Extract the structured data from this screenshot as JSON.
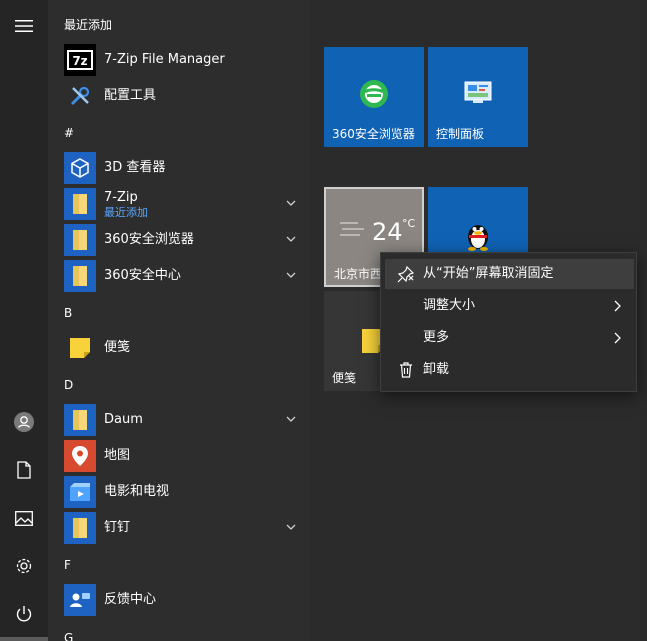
{
  "rail": {
    "icons": [
      "hamburger-menu-icon",
      "user-avatar-icon",
      "documents-icon",
      "pictures-icon",
      "settings-gear-icon",
      "power-icon"
    ]
  },
  "applist": {
    "sections": [
      {
        "letter": "最近添加"
      },
      {
        "letter": "#"
      },
      {
        "letter": "B"
      },
      {
        "letter": "D"
      },
      {
        "letter": "F"
      },
      {
        "letter": "G"
      }
    ],
    "apps": [
      {
        "label": "7-Zip File Manager",
        "icon": "7zip-icon"
      },
      {
        "label": "配置工具",
        "icon": "tools-icon"
      },
      {
        "label": "3D 查看器",
        "icon": "3d-viewer-icon"
      },
      {
        "label": "7-Zip",
        "sublabel": "最近添加",
        "icon": "folder-icon",
        "expandable": true
      },
      {
        "label": "360安全浏览器",
        "icon": "folder-icon",
        "expandable": true
      },
      {
        "label": "360安全中心",
        "icon": "folder-icon",
        "expandable": true
      },
      {
        "label": "便笺",
        "icon": "sticky-notes-icon"
      },
      {
        "label": "Daum",
        "icon": "folder-icon",
        "expandable": true
      },
      {
        "label": "地图",
        "icon": "maps-icon"
      },
      {
        "label": "电影和电视",
        "icon": "movies-tv-icon"
      },
      {
        "label": "钉钉",
        "icon": "folder-icon",
        "expandable": true
      },
      {
        "label": "反馈中心",
        "icon": "feedback-hub-icon"
      }
    ]
  },
  "tiles": {
    "browser": {
      "label": "360安全浏览器",
      "icon": "360-browser-icon"
    },
    "control_panel": {
      "label": "控制面板",
      "icon": "control-panel-icon"
    },
    "weather": {
      "temp": "24",
      "unit": "°C",
      "location": "北京市西"
    },
    "qq": {
      "icon": "qq-penguin-icon"
    },
    "sticky": {
      "label": "便笺",
      "icon": "sticky-notes-icon"
    }
  },
  "context_menu": {
    "items": [
      {
        "label": "从“开始”屏幕取消固定",
        "icon": "unpin-icon",
        "highlighted": true
      },
      {
        "label": "调整大小",
        "has_submenu": true
      },
      {
        "label": "更多",
        "has_submenu": true
      },
      {
        "label": "卸载",
        "icon": "trash-icon"
      }
    ]
  },
  "colors": {
    "tile_blue": "#1062b5",
    "accent_link": "#5aa9ff",
    "background": "#2b2b2b"
  }
}
